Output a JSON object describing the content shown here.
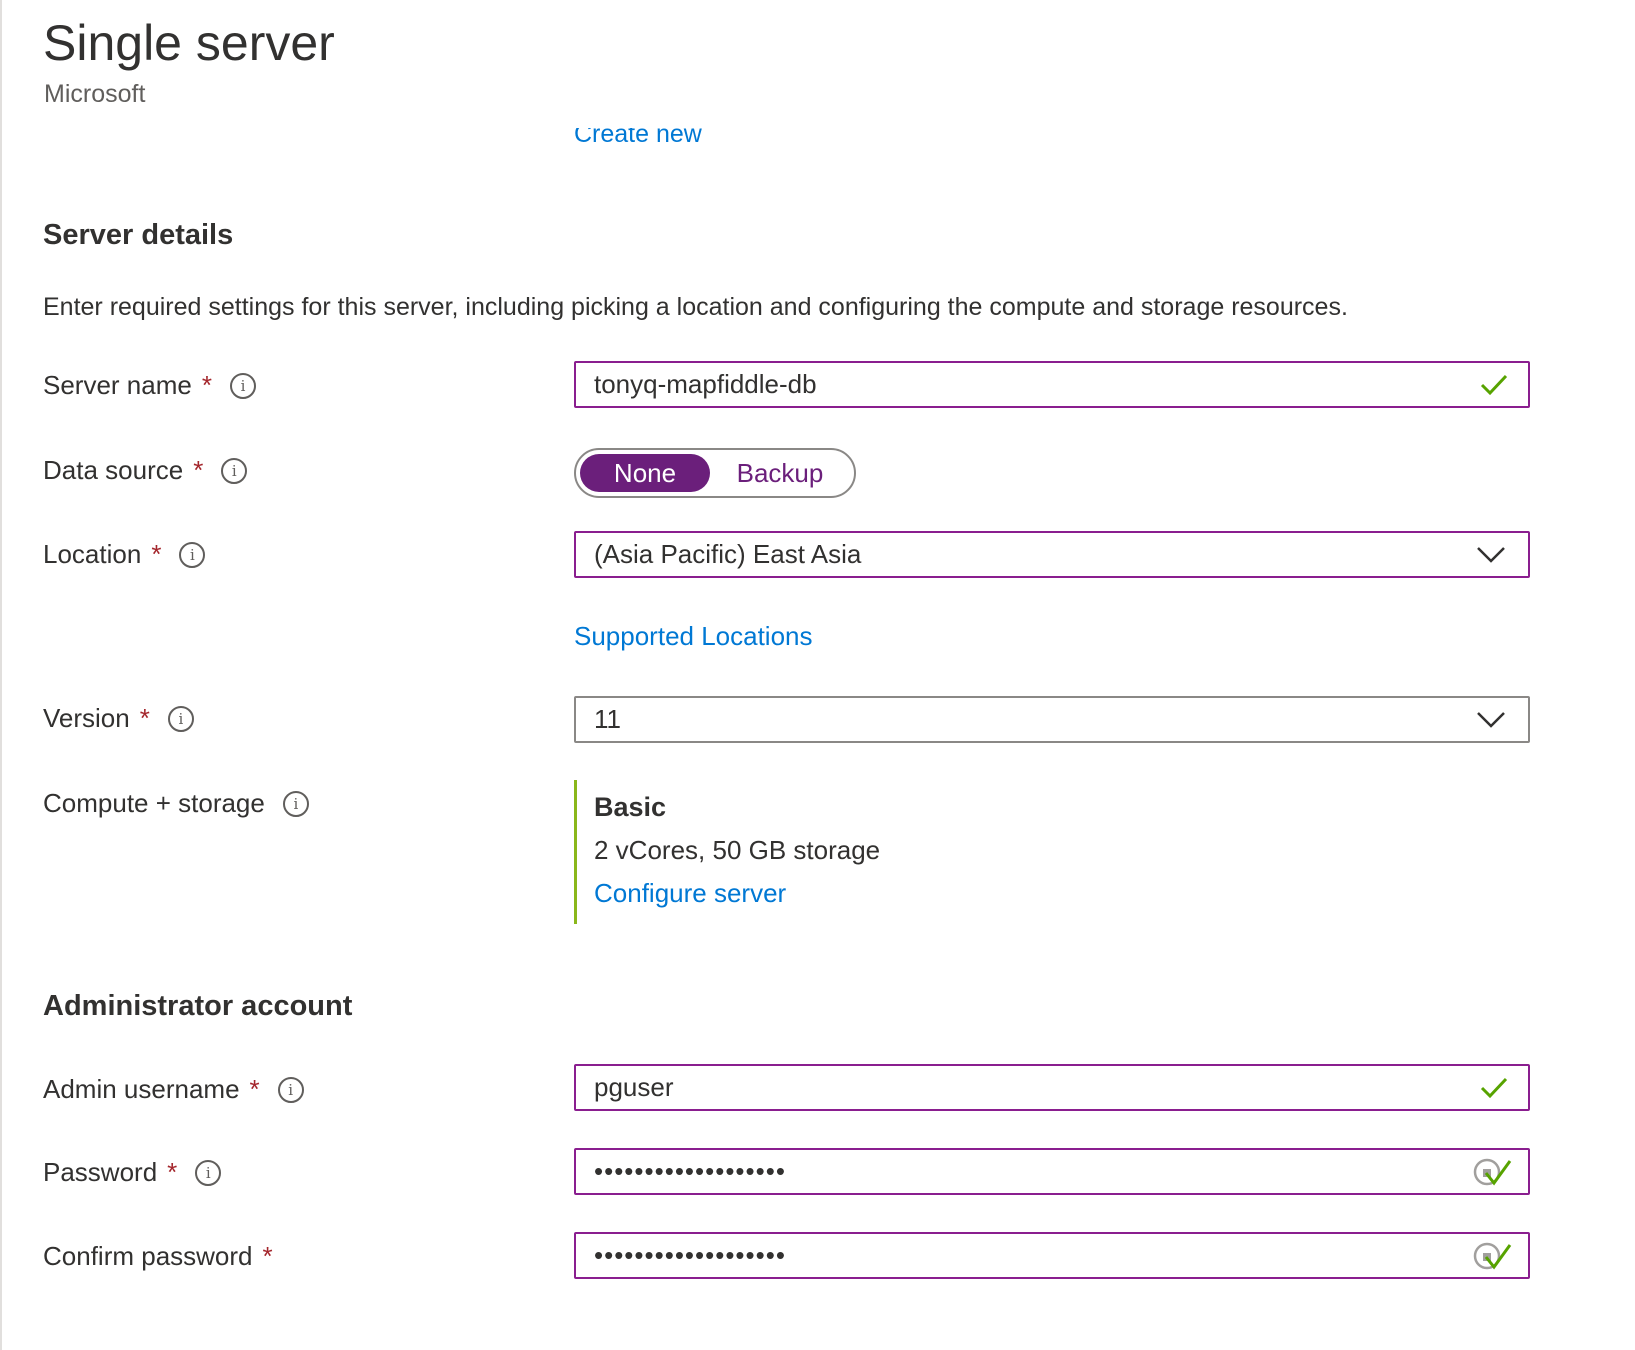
{
  "header": {
    "title": "Single server",
    "publisher": "Microsoft"
  },
  "resource_group": {
    "create_new_label": "Create new"
  },
  "server_details": {
    "heading": "Server details",
    "description": "Enter required settings for this server, including picking a location and configuring the compute and storage resources.",
    "server_name": {
      "label": "Server name",
      "required": "*",
      "value": "tonyq-mapfiddle-db",
      "valid": true
    },
    "data_source": {
      "label": "Data source",
      "required": "*",
      "options": [
        "None",
        "Backup"
      ],
      "selected": "None"
    },
    "location": {
      "label": "Location",
      "required": "*",
      "value": "(Asia Pacific) East Asia",
      "link": "Supported Locations"
    },
    "version": {
      "label": "Version",
      "required": "*",
      "value": "11"
    },
    "compute_storage": {
      "label": "Compute + storage",
      "tier": "Basic",
      "spec": "2 vCores, 50 GB storage",
      "link": "Configure server"
    }
  },
  "admin_account": {
    "heading": "Administrator account",
    "username": {
      "label": "Admin username",
      "required": "*",
      "value": "pguser",
      "valid": true
    },
    "password": {
      "label": "Password",
      "required": "*",
      "value": "•••••••••••••••••••",
      "valid": true
    },
    "confirm_password": {
      "label": "Confirm password",
      "required": "*",
      "value": "•••••••••••••••••••",
      "valid": true
    }
  },
  "icons": {
    "info": "i",
    "valid": "check-icon",
    "dropdown": "chevron-down-icon",
    "password": "password-reveal-icon"
  },
  "colors": {
    "accent_purple": "#6b1f7b",
    "input_border_focus": "#8a1e8f",
    "link": "#0078d4",
    "required": "#a4262c",
    "valid_check": "#57a300",
    "compute_bar": "#8ab71b"
  }
}
